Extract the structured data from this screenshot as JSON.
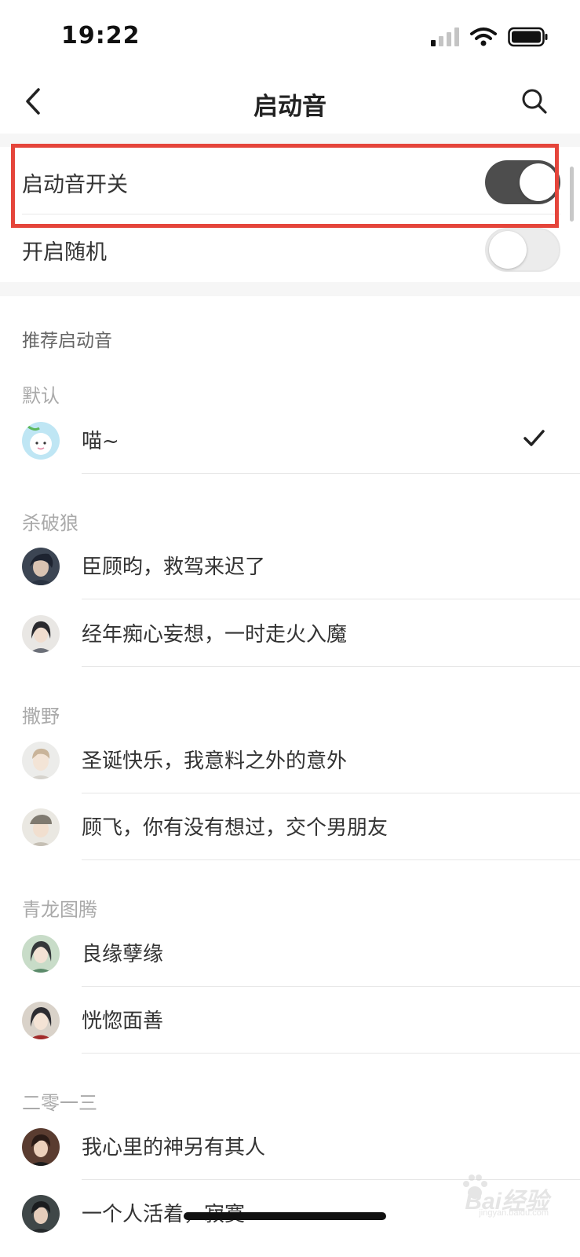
{
  "status_bar": {
    "time": "19:22"
  },
  "nav": {
    "title": "启动音"
  },
  "settings": {
    "startup_sound_switch": {
      "label": "启动音开关",
      "enabled": true
    },
    "random": {
      "label": "开启随机",
      "enabled": false
    }
  },
  "section_title": "推荐启动音",
  "groups": [
    {
      "title": "默认",
      "items": [
        {
          "label": "喵~",
          "selected": true
        }
      ]
    },
    {
      "title": "杀破狼",
      "items": [
        {
          "label": "臣顾昀，救驾来迟了"
        },
        {
          "label": "经年痴心妄想，一时走火入魔"
        }
      ]
    },
    {
      "title": "撒野",
      "items": [
        {
          "label": "圣诞快乐，我意料之外的意外"
        },
        {
          "label": "顾飞，你有没有想过，交个男朋友"
        }
      ]
    },
    {
      "title": "青龙图腾",
      "items": [
        {
          "label": "良缘孽缘"
        },
        {
          "label": "恍惚面善"
        }
      ]
    },
    {
      "title": "二零一三",
      "items": [
        {
          "label": "我心里的神另有其人"
        },
        {
          "label": "一个人活着，寂寞"
        }
      ]
    }
  ],
  "watermark": {
    "brand": "Bai经验",
    "url": "jingyan.baidu.com"
  },
  "colors": {
    "toggle_on": "#4d4d4d",
    "highlight": "#e5453b"
  }
}
